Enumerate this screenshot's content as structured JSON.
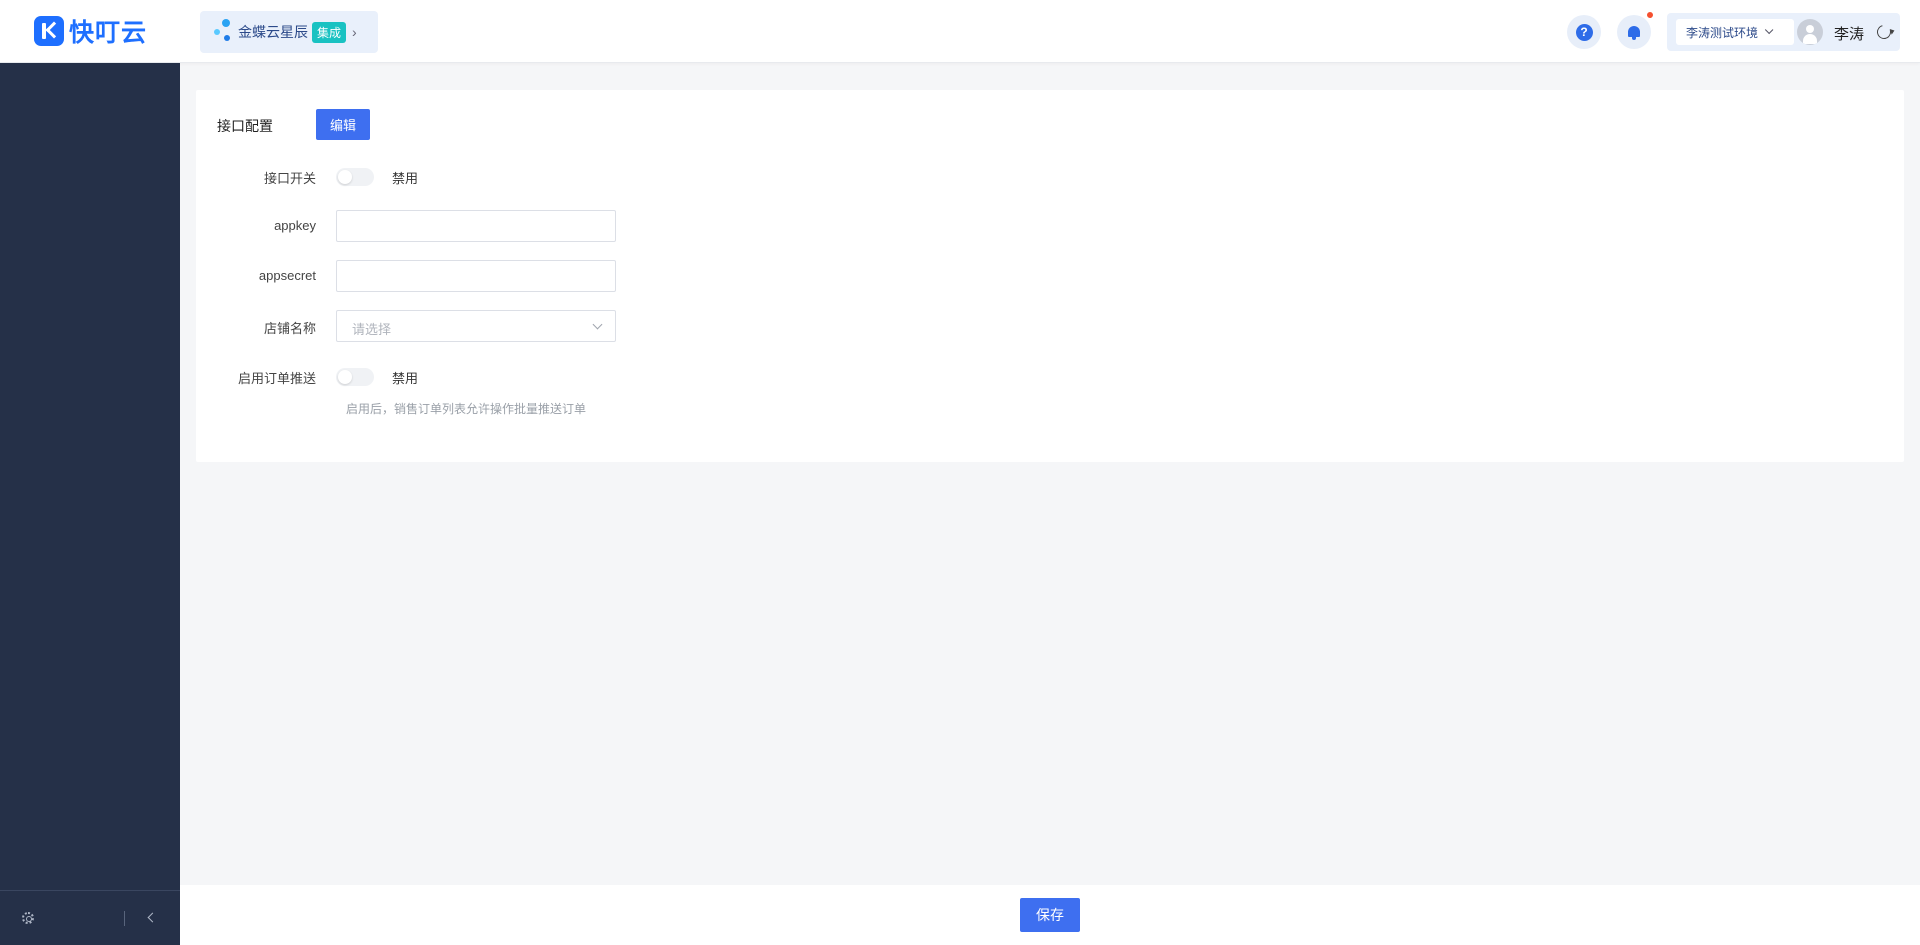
{
  "header": {
    "logo_text": "快叮云",
    "app": {
      "name": "金蝶云星辰",
      "badge": "集成"
    },
    "environment": "李涛测试环境",
    "user_name": "李涛"
  },
  "config": {
    "section_title": "接口配置",
    "edit_label": "编辑",
    "fields": {
      "api_switch": {
        "label": "接口开关",
        "state_text": "禁用",
        "enabled": false
      },
      "appkey": {
        "label": "appkey",
        "value": ""
      },
      "appsecret": {
        "label": "appsecret",
        "value": ""
      },
      "shop_name": {
        "label": "店铺名称",
        "placeholder": "请选择"
      },
      "order_push": {
        "label": "启用订单推送",
        "state_text": "禁用",
        "enabled": false
      }
    },
    "hint": "启用后，销售订单列表允许操作批量推送订单"
  },
  "footer": {
    "save_label": "保存"
  },
  "colors": {
    "primary": "#3e6ff0",
    "sidebar": "#253048",
    "brand": "#1e6fff",
    "badge": "#19c2c2",
    "notification": "#f5502f"
  }
}
